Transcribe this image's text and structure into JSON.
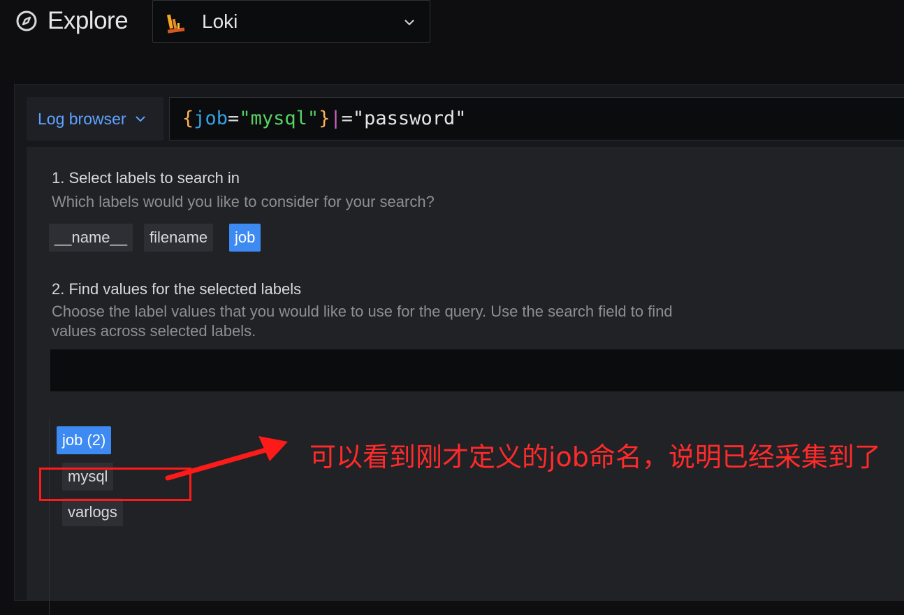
{
  "header": {
    "title": "Explore",
    "datasource": "Loki"
  },
  "query": {
    "mode_button": "Log browser",
    "tokens": {
      "open_brace": "{",
      "label": "job",
      "equals": "=",
      "value": "\"mysql\"",
      "close_brace": "}",
      "pipe": "|",
      "filter_op": "=",
      "filter_value": "\"password\""
    }
  },
  "browser": {
    "step1": {
      "title": "1. Select labels to search in",
      "description": "Which labels would you like to consider for your search?",
      "labels": [
        {
          "label": "__name__",
          "selected": false
        },
        {
          "label": "filename",
          "selected": false
        },
        {
          "label": "job",
          "selected": true
        }
      ]
    },
    "step2": {
      "title": "2. Find values for the selected labels",
      "description": "Choose the label values that you would like to use for the query. Use the search field to find values across selected labels.",
      "search_value": "",
      "group": "job (2)",
      "values": [
        "mysql",
        "varlogs"
      ]
    }
  },
  "annotation": {
    "text": "可以看到刚才定义的job命名，说明已经采集到了",
    "color": "#ff2a2a"
  },
  "colors": {
    "accent": "#3d8bf2",
    "link": "#5ea2ff"
  },
  "icons": {
    "explore": "compass-icon",
    "datasource": "loki-logo-icon",
    "dropdown": "chevron-down-icon"
  }
}
